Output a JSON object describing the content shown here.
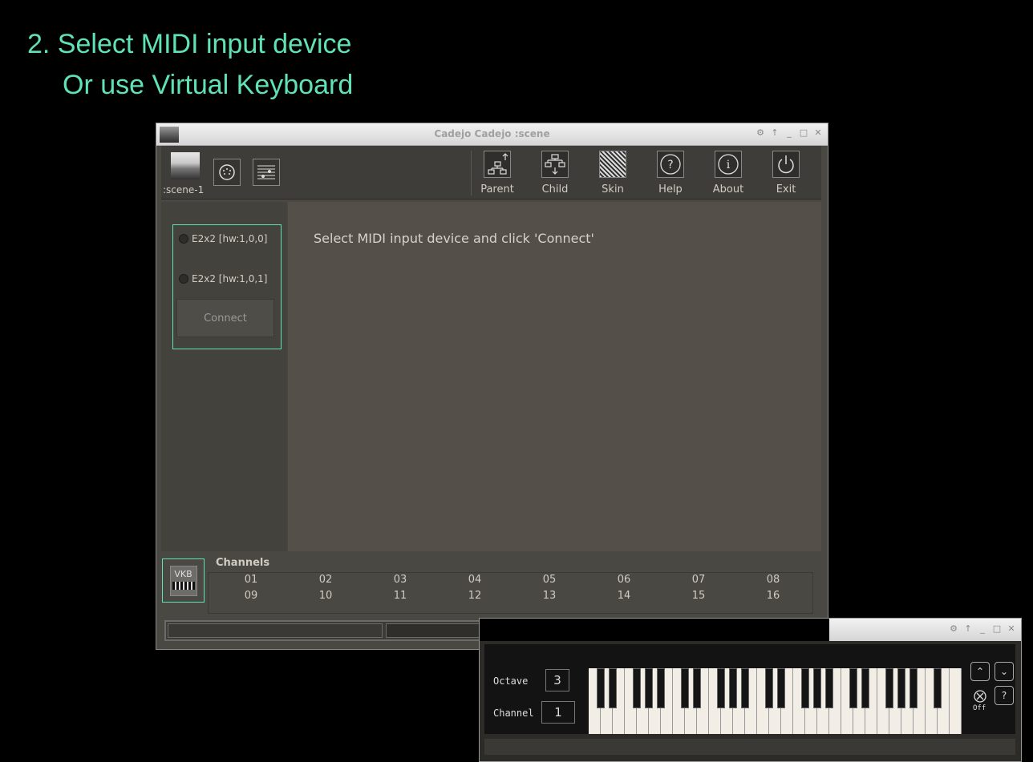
{
  "captions": {
    "line1": "2. Select MIDI input device",
    "line2": "Or use Virtual Keyboard"
  },
  "window": {
    "title": "Cadejo Cadejo :scene"
  },
  "toolbar": {
    "scene_label": ":scene-1",
    "buttons": [
      {
        "label": "Parent",
        "icon": "parent-tree-icon"
      },
      {
        "label": "Child",
        "icon": "child-tree-icon"
      },
      {
        "label": "Skin",
        "icon": "skin-pattern-icon"
      },
      {
        "label": "Help",
        "icon": "help-question-icon"
      },
      {
        "label": "About",
        "icon": "info-icon"
      },
      {
        "label": "Exit",
        "icon": "power-icon"
      }
    ]
  },
  "devices": [
    "E2x2 [hw:1,0,0]",
    "E2x2 [hw:1,0,1]"
  ],
  "connect_label": "Connect",
  "hint": "Select MIDI input device and click 'Connect'",
  "vkb_label": "VKB",
  "channels": {
    "title": "Channels",
    "row1": [
      "01",
      "02",
      "03",
      "04",
      "05",
      "06",
      "07",
      "08"
    ],
    "row2": [
      "09",
      "10",
      "11",
      "12",
      "13",
      "14",
      "15",
      "16"
    ]
  },
  "keyboard": {
    "octave_label": "Octave",
    "octave_value": "3",
    "channel_label": "Channel",
    "channel_value": "1",
    "off_label": "Off",
    "help_label": "?"
  },
  "colors": {
    "accent": "#5fe3b4",
    "panel": "#4a4843"
  }
}
